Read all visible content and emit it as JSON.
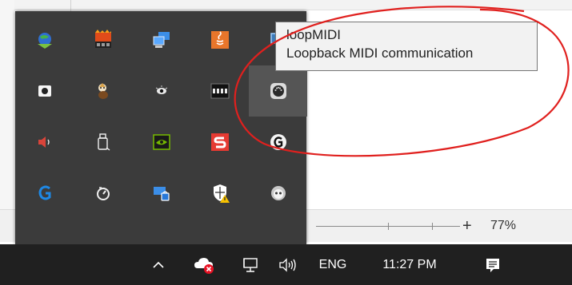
{
  "tooltip": {
    "title": "loopMIDI",
    "description": "Loopback MIDI communication"
  },
  "status_bar": {
    "zoom_plus": "+",
    "zoom_value": "77%"
  },
  "tray_icons": [
    {
      "icon": "globe-download-icon"
    },
    {
      "icon": "ram-disk-icon"
    },
    {
      "icon": "network-computers-icon"
    },
    {
      "icon": "java-icon"
    },
    {
      "icon": "loopmidi-icon"
    },
    {
      "icon": "record-icon"
    },
    {
      "icon": "mascot-icon"
    },
    {
      "icon": "eye-icon"
    },
    {
      "icon": "ssd-icon"
    },
    {
      "icon": "midi-port-icon",
      "hovered": true
    },
    {
      "icon": "speaker-icon"
    },
    {
      "icon": "usb-drive-icon"
    },
    {
      "icon": "nvidia-icon"
    },
    {
      "icon": "s-app-icon"
    },
    {
      "icon": "logitech-g-icon"
    },
    {
      "icon": "logitech-g-blue-icon"
    },
    {
      "icon": "clock-gauge-icon"
    },
    {
      "icon": "drive-lock-icon"
    },
    {
      "icon": "security-warning-icon"
    },
    {
      "icon": "panda-icon"
    }
  ],
  "taskbar": {
    "language": "ENG",
    "time": "11:27 PM"
  },
  "colors": {
    "taskbar": "#202020",
    "tray_panel": "#3b3b3b",
    "annotation": "#e0201e"
  }
}
